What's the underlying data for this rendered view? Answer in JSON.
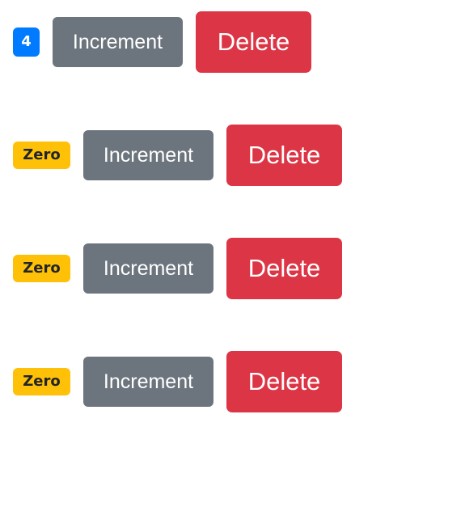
{
  "counters": [
    {
      "badge": "4",
      "increment_label": "Increment",
      "delete_label": "Delete"
    },
    {
      "badge": "Zero",
      "increment_label": "Increment",
      "delete_label": "Delete"
    },
    {
      "badge": "Zero",
      "increment_label": "Increment",
      "delete_label": "Delete"
    },
    {
      "badge": "Zero",
      "increment_label": "Increment",
      "delete_label": "Delete"
    }
  ],
  "colors": {
    "badge_primary": "#007bff",
    "badge_warning": "#ffc107",
    "button_secondary": "#6c757d",
    "button_danger": "#dc3545"
  }
}
